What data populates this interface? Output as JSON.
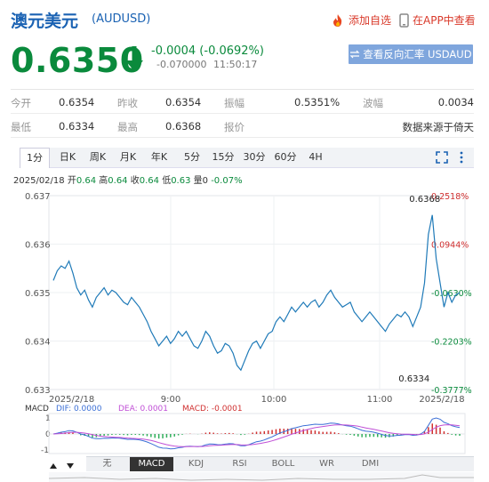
{
  "header": {
    "name": "澳元美元",
    "code": "(AUDUSD)",
    "add_watch": "添加自选",
    "app_view": "在APP中查看"
  },
  "quote": {
    "price": "0.6350",
    "change": "-0.0004 (-0.0692%)",
    "sub_change": "-0.070000",
    "time": "11:50:17",
    "reverse_button": "查看反向汇率 USDAUD"
  },
  "stats": [
    [
      {
        "label": "今开",
        "value": "0.6354"
      },
      {
        "label": "昨收",
        "value": "0.6354"
      },
      {
        "label": "振幅",
        "value": "0.5351%"
      },
      {
        "label": "波幅",
        "value": "0.0034"
      }
    ],
    [
      {
        "label": "最低",
        "value": "0.6334"
      },
      {
        "label": "最高",
        "value": "0.6368"
      },
      {
        "label": "报价",
        "value": ""
      },
      {
        "label": "",
        "value": "数据来源于倚天"
      }
    ]
  ],
  "tabs": [
    "1分",
    "日K",
    "周K",
    "月K",
    "年K",
    "5分",
    "15分",
    "30分",
    "60分",
    "4H"
  ],
  "active_tab": "1分",
  "info": {
    "date": "2025/02/18",
    "open_label": "开",
    "open": "0.64",
    "high_label": "高",
    "high": "0.64",
    "close_label": "收",
    "close": "0.64",
    "low_label": "低",
    "low": "0.63",
    "vol_label": "量",
    "vol": "0",
    "pct": "-0.07%"
  },
  "chart_data": {
    "type": "line",
    "y_ticks": [
      "0.637",
      "0.636",
      "0.635",
      "0.634",
      "0.633"
    ],
    "ylim": [
      0.633,
      0.637
    ],
    "x_ticks": [
      "2025/2/18",
      "9:00",
      "10:00",
      "11:00",
      "2025/2/18"
    ],
    "pct_ticks": [
      "0.2518%",
      "0.0944%",
      "-0.0630%",
      "-0.2203%",
      "-0.3777%"
    ],
    "max_label": "0.6368",
    "min_label": "0.6334",
    "line_color": "#1f7ab8",
    "series": [
      {
        "values": [
          0.63525,
          0.63545,
          0.63555,
          0.6355,
          0.63565,
          0.6354,
          0.6351,
          0.63495,
          0.63505,
          0.63485,
          0.6347,
          0.6349,
          0.635,
          0.6351,
          0.63495,
          0.63505,
          0.635,
          0.6349,
          0.6348,
          0.63475,
          0.6349,
          0.6348,
          0.6347,
          0.63455,
          0.6344,
          0.6342,
          0.63405,
          0.6339,
          0.634,
          0.6341,
          0.63395,
          0.63405,
          0.6342,
          0.6341,
          0.6342,
          0.63405,
          0.6339,
          0.63385,
          0.634,
          0.6342,
          0.6341,
          0.6339,
          0.63375,
          0.6338,
          0.63395,
          0.6339,
          0.63375,
          0.6335,
          0.6334,
          0.6336,
          0.6338,
          0.63395,
          0.634,
          0.63385,
          0.634,
          0.63415,
          0.6342,
          0.6344,
          0.6345,
          0.6344,
          0.63455,
          0.6347,
          0.6346,
          0.6347,
          0.6348,
          0.6347,
          0.6348,
          0.63485,
          0.6347,
          0.6348,
          0.63495,
          0.63505,
          0.6349,
          0.6348,
          0.6347,
          0.63475,
          0.6348,
          0.6346,
          0.6345,
          0.6344,
          0.6345,
          0.6346,
          0.6345,
          0.6344,
          0.6343,
          0.6342,
          0.63435,
          0.63445,
          0.63455,
          0.6345,
          0.6346,
          0.6345,
          0.6343,
          0.6345,
          0.6347,
          0.6352,
          0.6362,
          0.6366,
          0.6357,
          0.6352,
          0.6347,
          0.635,
          0.6348,
          0.63495,
          0.635
        ]
      }
    ]
  },
  "macd": {
    "label": "MACD",
    "dif": "DIF: 0.0000",
    "dea": "DEA: 0.0001",
    "macd": "MACD: -0.0001",
    "ticks": [
      "1",
      "0",
      "-1"
    ],
    "dif_color": "#3b6fd6",
    "dea_color": "#c04fd6",
    "macd_color": "#d03030"
  },
  "bottom_tabs": [
    "无",
    "MACD",
    "KDJ",
    "RSI",
    "BOLL",
    "WR",
    "DMI"
  ],
  "active_bottom": "MACD"
}
